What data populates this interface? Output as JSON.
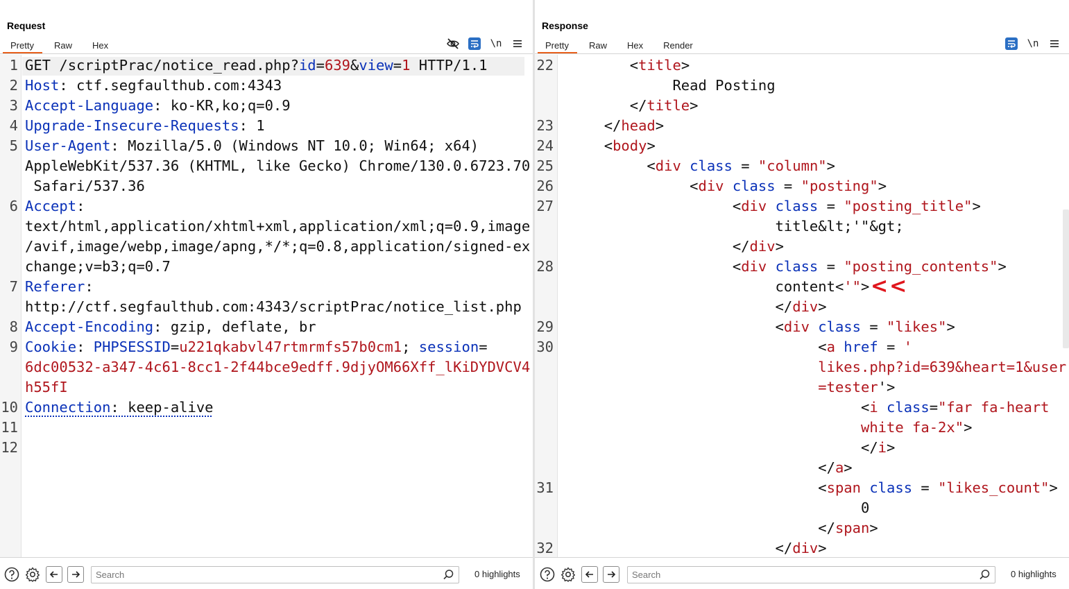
{
  "request": {
    "title": "Request",
    "tabs": [
      "Pretty",
      "Raw",
      "Hex"
    ],
    "active_tab": "Pretty",
    "newline_label": "\\n",
    "search_placeholder": "Search",
    "highlights": "0 highlights",
    "lines": [
      {
        "n": "1",
        "rows": [
          [
            [
              "ink",
              "GET /scriptPrac/notice_read.php?"
            ],
            [
              "blue",
              "id"
            ],
            [
              "ink",
              "="
            ],
            [
              "red",
              "639"
            ],
            [
              "ink",
              "&"
            ],
            [
              "blue",
              "view"
            ],
            [
              "ink",
              "="
            ],
            [
              "red",
              "1"
            ],
            [
              "ink",
              " HTTP/1.1"
            ]
          ]
        ]
      },
      {
        "n": "2",
        "rows": [
          [
            [
              "blue",
              "Host"
            ],
            [
              "ink",
              ": ctf.segfaulthub.com:4343"
            ]
          ]
        ]
      },
      {
        "n": "3",
        "rows": [
          [
            [
              "blue",
              "Accept-Language"
            ],
            [
              "ink",
              ": ko-KR,ko;q=0.9"
            ]
          ]
        ]
      },
      {
        "n": "4",
        "rows": [
          [
            [
              "blue",
              "Upgrade-Insecure-Requests"
            ],
            [
              "ink",
              ": 1"
            ]
          ]
        ]
      },
      {
        "n": "5",
        "rows": [
          [
            [
              "blue",
              "User-Agent"
            ],
            [
              "ink",
              ": Mozilla/5.0 (Windows NT 10.0; Win64; x64)"
            ]
          ],
          [
            [
              "ink",
              "AppleWebKit/537.36 (KHTML, like Gecko) Chrome/130.0.6723.70"
            ]
          ],
          [
            [
              "ink",
              " Safari/537.36"
            ]
          ]
        ]
      },
      {
        "n": "6",
        "rows": [
          [
            [
              "blue",
              "Accept"
            ],
            [
              "ink",
              ":"
            ]
          ],
          [
            [
              "ink",
              "text/html,application/xhtml+xml,application/xml;q=0.9,image"
            ]
          ],
          [
            [
              "ink",
              "/avif,image/webp,image/apng,*/*;q=0.8,application/signed-ex"
            ]
          ],
          [
            [
              "ink",
              "change;v=b3;q=0.7"
            ]
          ]
        ]
      },
      {
        "n": "7",
        "rows": [
          [
            [
              "blue",
              "Referer"
            ],
            [
              "ink",
              ":"
            ]
          ],
          [
            [
              "ink",
              "http://ctf.segfaulthub.com:4343/scriptPrac/notice_list.php"
            ]
          ]
        ]
      },
      {
        "n": "8",
        "rows": [
          [
            [
              "blue",
              "Accept-Encoding"
            ],
            [
              "ink",
              ": gzip, deflate, br"
            ]
          ]
        ]
      },
      {
        "n": "9",
        "rows": [
          [
            [
              "blue",
              "Cookie"
            ],
            [
              "ink",
              ": "
            ],
            [
              "blue",
              "PHPSESSID"
            ],
            [
              "ink",
              "="
            ],
            [
              "red",
              "u221qkabvl47rtmrmfs57b0cm1"
            ],
            [
              "ink",
              "; "
            ],
            [
              "blue",
              "session"
            ],
            [
              "ink",
              "="
            ]
          ],
          [
            [
              "red",
              "6dc00532-a347-4c61-8cc1-2f44bce9edff.9djyOM66Xff_lKiDYDVCV4"
            ]
          ],
          [
            [
              "red",
              "h55fI"
            ]
          ]
        ]
      },
      {
        "n": "10",
        "rows": [
          [
            [
              "blue dotted",
              "Connection"
            ],
            [
              "ink dotted",
              ": keep-alive"
            ]
          ]
        ]
      },
      {
        "n": "11",
        "rows": [
          [
            [
              "ink",
              ""
            ]
          ]
        ]
      },
      {
        "n": "12",
        "rows": [
          [
            [
              "ink",
              ""
            ]
          ]
        ]
      }
    ]
  },
  "response": {
    "title": "Response",
    "tabs": [
      "Pretty",
      "Raw",
      "Hex",
      "Render"
    ],
    "active_tab": "Pretty",
    "newline_label": "\\n",
    "search_placeholder": "Search",
    "highlights": "0 highlights",
    "annotation": "<<",
    "lines": [
      {
        "n": "22",
        "rows": [
          [
            [
              "ink",
              "        <"
            ],
            [
              "red",
              "title"
            ],
            [
              "ink",
              ">"
            ]
          ],
          [
            [
              "ink",
              "             Read Posting"
            ]
          ],
          [
            [
              "ink",
              "        </"
            ],
            [
              "red",
              "title"
            ],
            [
              "ink",
              ">"
            ]
          ]
        ]
      },
      {
        "n": "23",
        "rows": [
          [
            [
              "ink",
              "     </"
            ],
            [
              "red",
              "head"
            ],
            [
              "ink",
              ">"
            ]
          ]
        ]
      },
      {
        "n": "24",
        "rows": [
          [
            [
              "ink",
              "     <"
            ],
            [
              "red",
              "body"
            ],
            [
              "ink",
              ">"
            ]
          ]
        ]
      },
      {
        "n": "25",
        "rows": [
          [
            [
              "ink",
              "          <"
            ],
            [
              "red",
              "div"
            ],
            [
              "ink",
              " "
            ],
            [
              "blue",
              "class"
            ],
            [
              "ink",
              " = "
            ],
            [
              "red",
              "\"column\""
            ],
            [
              "ink",
              ">"
            ]
          ]
        ]
      },
      {
        "n": "26",
        "rows": [
          [
            [
              "ink",
              "               <"
            ],
            [
              "red",
              "div"
            ],
            [
              "ink",
              " "
            ],
            [
              "blue",
              "class"
            ],
            [
              "ink",
              " = "
            ],
            [
              "red",
              "\"posting\""
            ],
            [
              "ink",
              ">"
            ]
          ]
        ]
      },
      {
        "n": "27",
        "rows": [
          [
            [
              "ink",
              "                    <"
            ],
            [
              "red",
              "div"
            ],
            [
              "ink",
              " "
            ],
            [
              "blue",
              "class"
            ],
            [
              "ink",
              " = "
            ],
            [
              "red",
              "\"posting_title\""
            ],
            [
              "ink",
              ">"
            ]
          ],
          [
            [
              "ink",
              "                         title&lt;'\"&gt;"
            ]
          ],
          [
            [
              "ink",
              "                    </"
            ],
            [
              "red",
              "div"
            ],
            [
              "ink",
              ">"
            ]
          ]
        ]
      },
      {
        "n": "28",
        "rows": [
          [
            [
              "ink",
              "                    <"
            ],
            [
              "red",
              "div"
            ],
            [
              "ink",
              " "
            ],
            [
              "blue",
              "class"
            ],
            [
              "ink",
              " = "
            ],
            [
              "red",
              "\"posting_contents\""
            ],
            [
              "ink",
              ">"
            ]
          ],
          [
            [
              "ink",
              "                         content<"
            ],
            [
              "red",
              "'\""
            ],
            [
              "ink",
              ">"
            ]
          ],
          [
            [
              "ink",
              "                         </"
            ],
            [
              "red",
              "div"
            ],
            [
              "ink",
              ">"
            ]
          ]
        ]
      },
      {
        "n": "29",
        "rows": [
          [
            [
              "ink",
              "                         <"
            ],
            [
              "red",
              "div"
            ],
            [
              "ink",
              " "
            ],
            [
              "blue",
              "class"
            ],
            [
              "ink",
              " = "
            ],
            [
              "red",
              "\"likes\""
            ],
            [
              "ink",
              ">"
            ]
          ]
        ]
      },
      {
        "n": "30",
        "rows": [
          [
            [
              "ink",
              "                              <"
            ],
            [
              "red",
              "a"
            ],
            [
              "ink",
              " "
            ],
            [
              "blue",
              "href"
            ],
            [
              "ink",
              " = "
            ],
            [
              "red",
              "'"
            ]
          ],
          [
            [
              "red",
              "                              likes.php?id=639&heart=1&user"
            ]
          ],
          [
            [
              "red",
              "                              =tester"
            ],
            [
              "ink",
              "'>"
            ]
          ],
          [
            [
              "ink",
              "                                   <"
            ],
            [
              "red",
              "i"
            ],
            [
              "ink",
              " "
            ],
            [
              "blue",
              "class"
            ],
            [
              "ink",
              "="
            ],
            [
              "red",
              "\"far fa-heart"
            ]
          ],
          [
            [
              "red",
              "                                   white fa-2x\""
            ],
            [
              "ink",
              ">"
            ]
          ],
          [
            [
              "ink",
              "                                   </"
            ],
            [
              "red",
              "i"
            ],
            [
              "ink",
              ">"
            ]
          ],
          [
            [
              "ink",
              "                              </"
            ],
            [
              "red",
              "a"
            ],
            [
              "ink",
              ">"
            ]
          ]
        ]
      },
      {
        "n": "31",
        "rows": [
          [
            [
              "ink",
              "                              <"
            ],
            [
              "red",
              "span"
            ],
            [
              "ink",
              " "
            ],
            [
              "blue",
              "class"
            ],
            [
              "ink",
              " = "
            ],
            [
              "red",
              "\"likes_count\""
            ],
            [
              "ink",
              ">"
            ]
          ],
          [
            [
              "ink",
              "                                   0"
            ]
          ],
          [
            [
              "ink",
              "                              </"
            ],
            [
              "red",
              "span"
            ],
            [
              "ink",
              ">"
            ]
          ]
        ]
      },
      {
        "n": "32",
        "rows": [
          [
            [
              "ink",
              "                         </"
            ],
            [
              "red",
              "div"
            ],
            [
              "ink",
              ">"
            ]
          ]
        ]
      }
    ]
  },
  "icons": {
    "hide": "eye-off-icon",
    "wrap": "wrap-text-icon",
    "menu": "hamburger-menu-icon",
    "help": "help-icon",
    "settings": "gear-icon",
    "back": "arrow-left-icon",
    "forward": "arrow-right-icon",
    "search": "search-icon"
  },
  "colors": {
    "accent": "#e8601c",
    "keyword": "#0a31b8",
    "value": "#b0161d",
    "annotation": "#e0161d",
    "layout_active": "#2b6fc4"
  }
}
